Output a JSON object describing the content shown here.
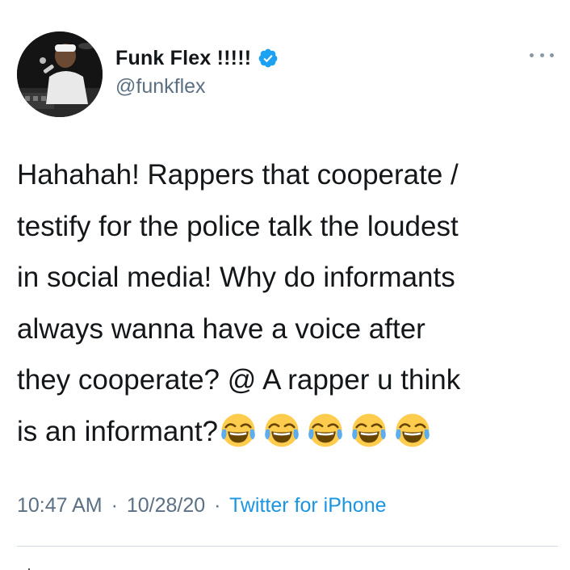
{
  "author": {
    "display_name": "Funk Flex !!!!!",
    "handle": "@funkflex",
    "verified": true,
    "avatar_icon": "profile-photo"
  },
  "tweet": {
    "lines": [
      "Hahahah! Rappers that cooperate /",
      "testify for the police talk the loudest",
      "in social media! Why do informants",
      "always wanna have a voice after",
      "they cooperate? @ A rapper u think",
      "is an informant?"
    ],
    "emojis": [
      "face-with-tears-of-joy",
      "face-with-tears-of-joy",
      "face-with-tears-of-joy",
      "face-with-tears-of-joy",
      "face-with-tears-of-joy"
    ]
  },
  "meta": {
    "time": "10:47 AM",
    "separator": "·",
    "date": "10/28/20",
    "source": "Twitter for iPhone"
  },
  "colors": {
    "text": "#14171a",
    "muted": "#5b7083",
    "link": "#1b95e0",
    "verified": "#1da1f2"
  },
  "icons": {
    "more": "more-options-icon",
    "verified": "verified-badge-icon"
  }
}
